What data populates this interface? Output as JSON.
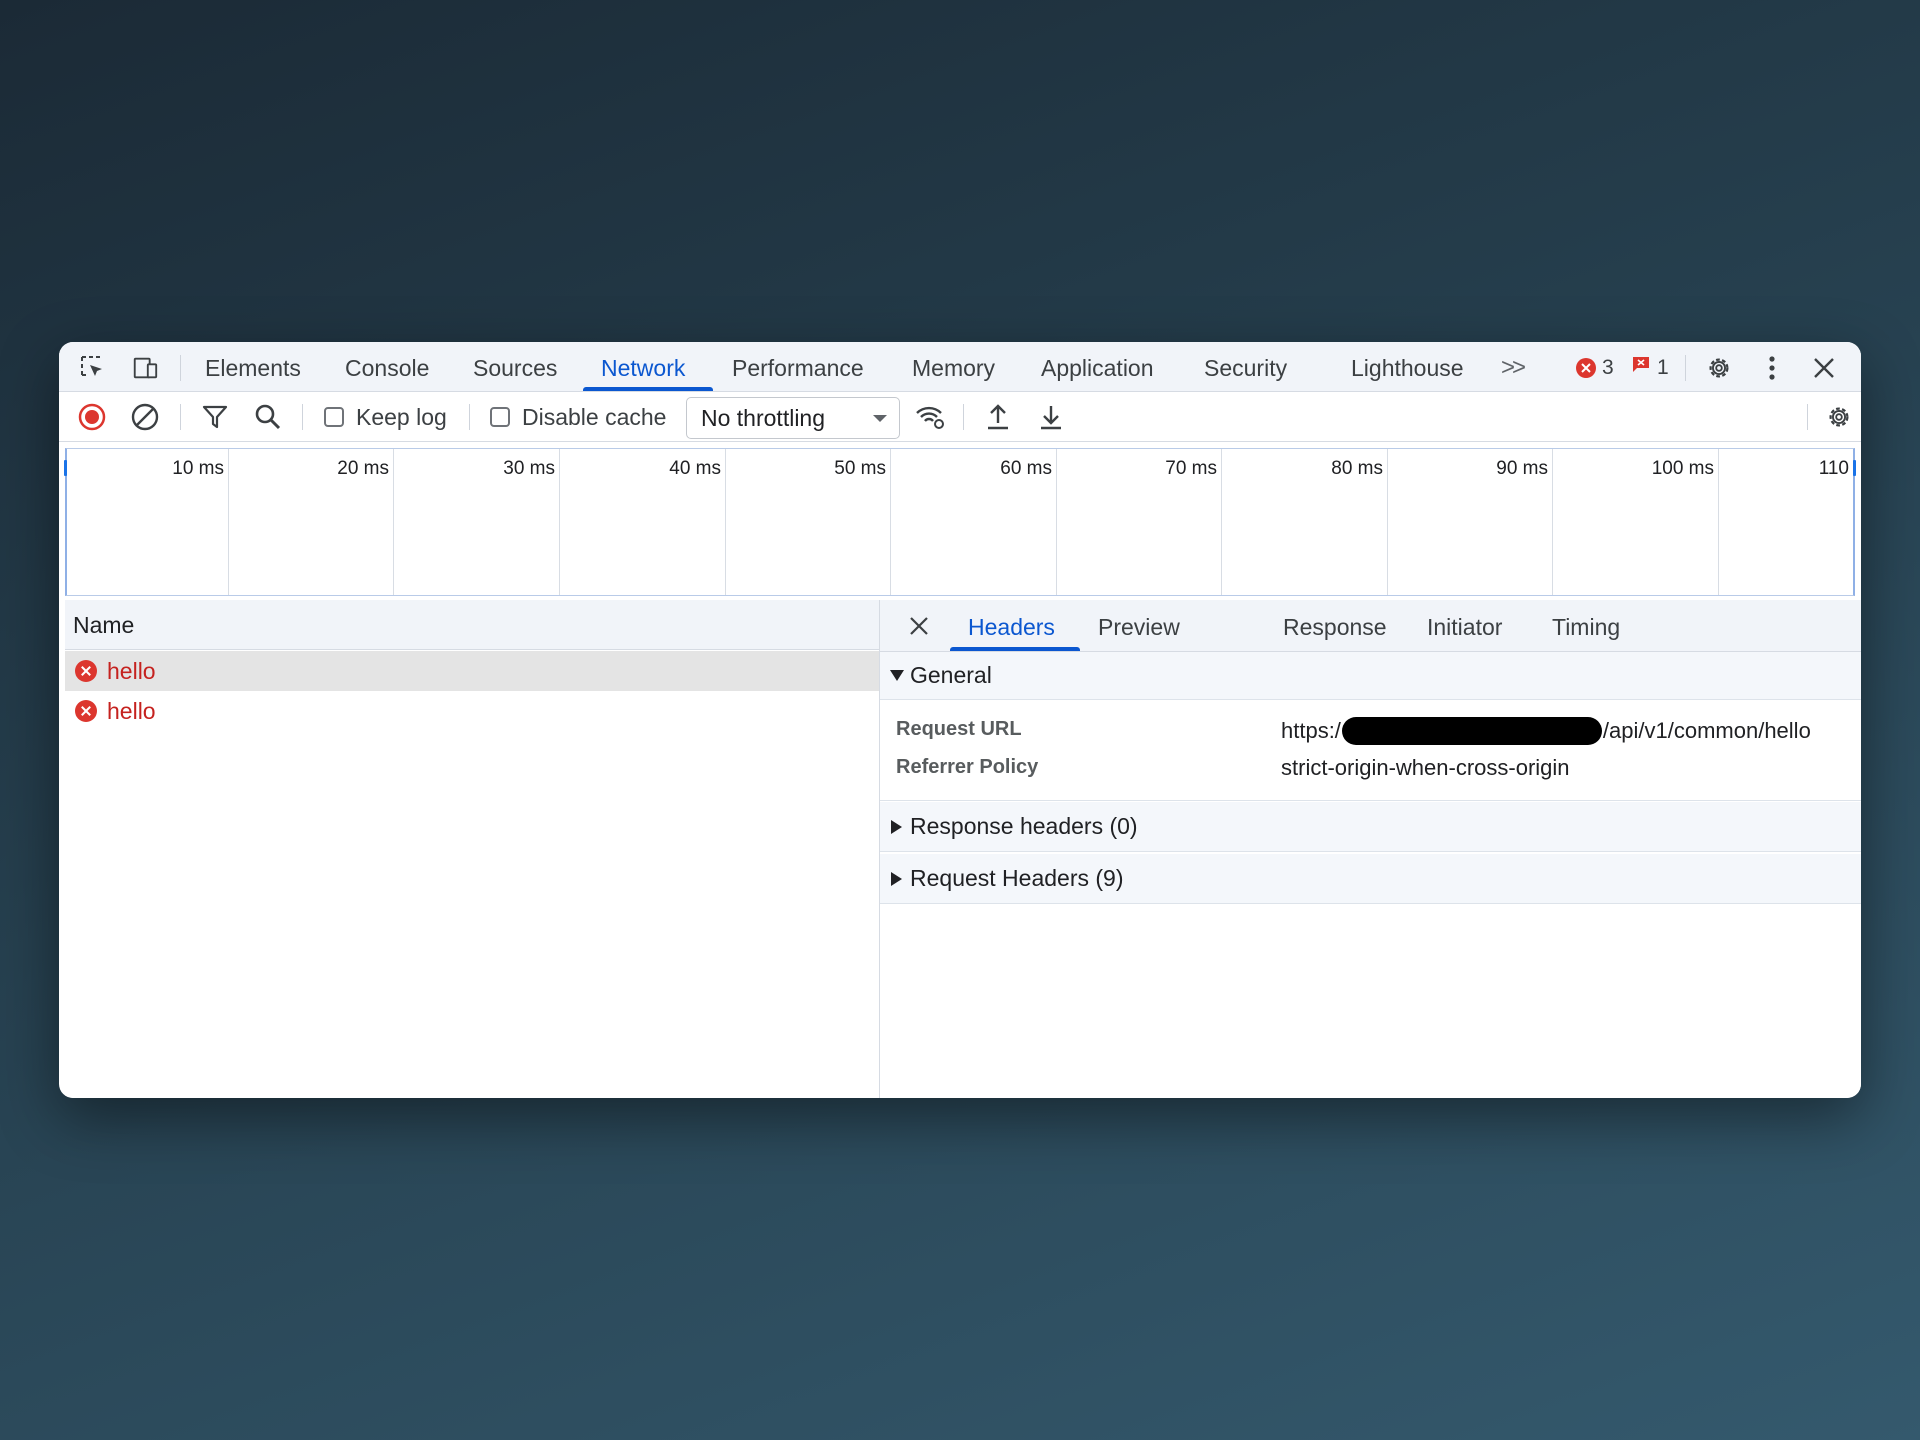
{
  "tabbar": {
    "tabs": [
      {
        "label": "Elements"
      },
      {
        "label": "Console"
      },
      {
        "label": "Sources"
      },
      {
        "label": "Network"
      },
      {
        "label": "Performance"
      },
      {
        "label": "Memory"
      },
      {
        "label": "Application"
      },
      {
        "label": "Security"
      },
      {
        "label": "Lighthouse"
      }
    ],
    "active_tab": "Network",
    "more_tabs_icon": ">>",
    "error_count": "3",
    "issue_count": "1"
  },
  "toolbar": {
    "keep_log_label": "Keep log",
    "disable_cache_label": "Disable cache",
    "throttling_value": "No throttling"
  },
  "timeline": {
    "ticks": [
      "10 ms",
      "20 ms",
      "30 ms",
      "40 ms",
      "50 ms",
      "60 ms",
      "70 ms",
      "80 ms",
      "90 ms",
      "100 ms",
      "110"
    ]
  },
  "requests": {
    "column_name": "Name",
    "rows": [
      {
        "name": "hello",
        "status": "error"
      },
      {
        "name": "hello",
        "status": "error"
      }
    ]
  },
  "details": {
    "tabs": [
      {
        "label": "Headers"
      },
      {
        "label": "Preview"
      },
      {
        "label": "Response"
      },
      {
        "label": "Initiator"
      },
      {
        "label": "Timing"
      }
    ],
    "active_tab": "Headers",
    "general": {
      "title": "General",
      "request_url_key": "Request URL",
      "request_url_prefix": "https:/",
      "request_url_suffix": "/api/v1/common/hello",
      "referrer_policy_key": "Referrer Policy",
      "referrer_policy_value": "strict-origin-when-cross-origin"
    },
    "response_headers_title": "Response headers (0)",
    "request_headers_title": "Request Headers (9)"
  },
  "colors": {
    "accent": "#0b57d0",
    "error": "#c5221f",
    "record_red": "#dc362e"
  }
}
